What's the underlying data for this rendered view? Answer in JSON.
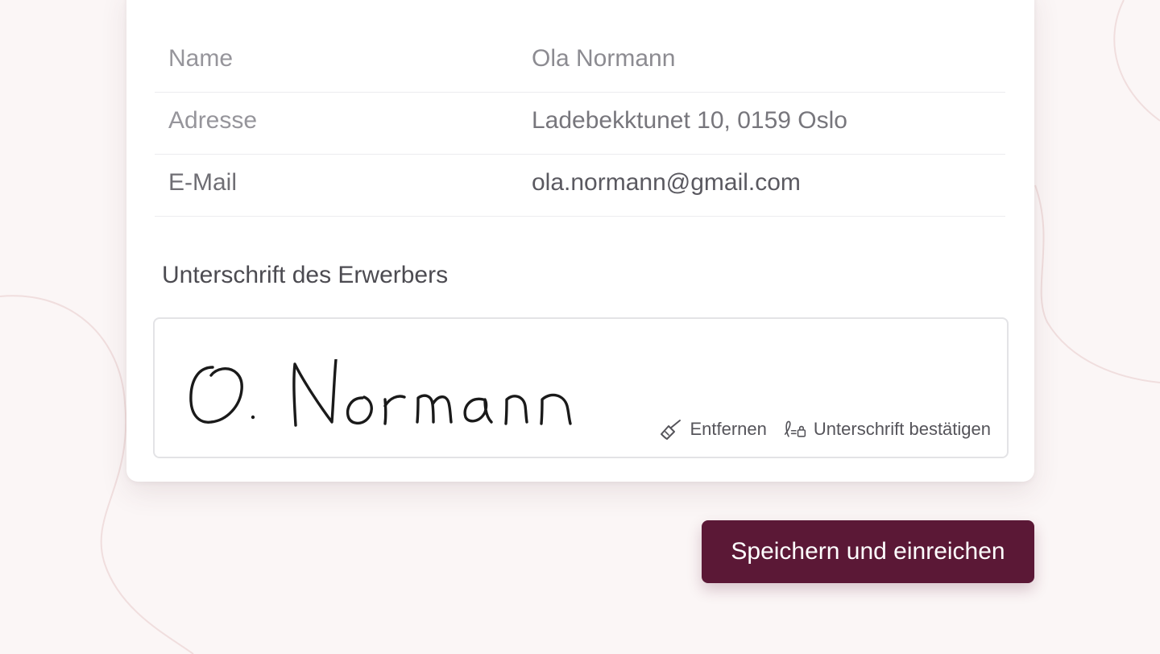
{
  "details": {
    "rows": [
      {
        "label": "Name",
        "value": "Ola Normann"
      },
      {
        "label": "Adresse",
        "value": "Ladebekktunet 10, 0159 Oslo"
      },
      {
        "label": "E-Mail",
        "value": "ola.normann@gmail.com"
      }
    ]
  },
  "signature": {
    "title": "Unterschrift des Erwerbers",
    "signed_name": "O. Normann",
    "actions": {
      "remove_label": "Entfernen",
      "remove_icon": "broom-icon",
      "confirm_label": "Unterschrift bestätigen",
      "confirm_icon": "signature-lock-icon"
    }
  },
  "submit": {
    "label": "Speichern und einreichen"
  },
  "colors": {
    "background": "#fbf6f6",
    "card": "#ffffff",
    "primary_button": "#5b1836",
    "divider": "#ececef"
  }
}
